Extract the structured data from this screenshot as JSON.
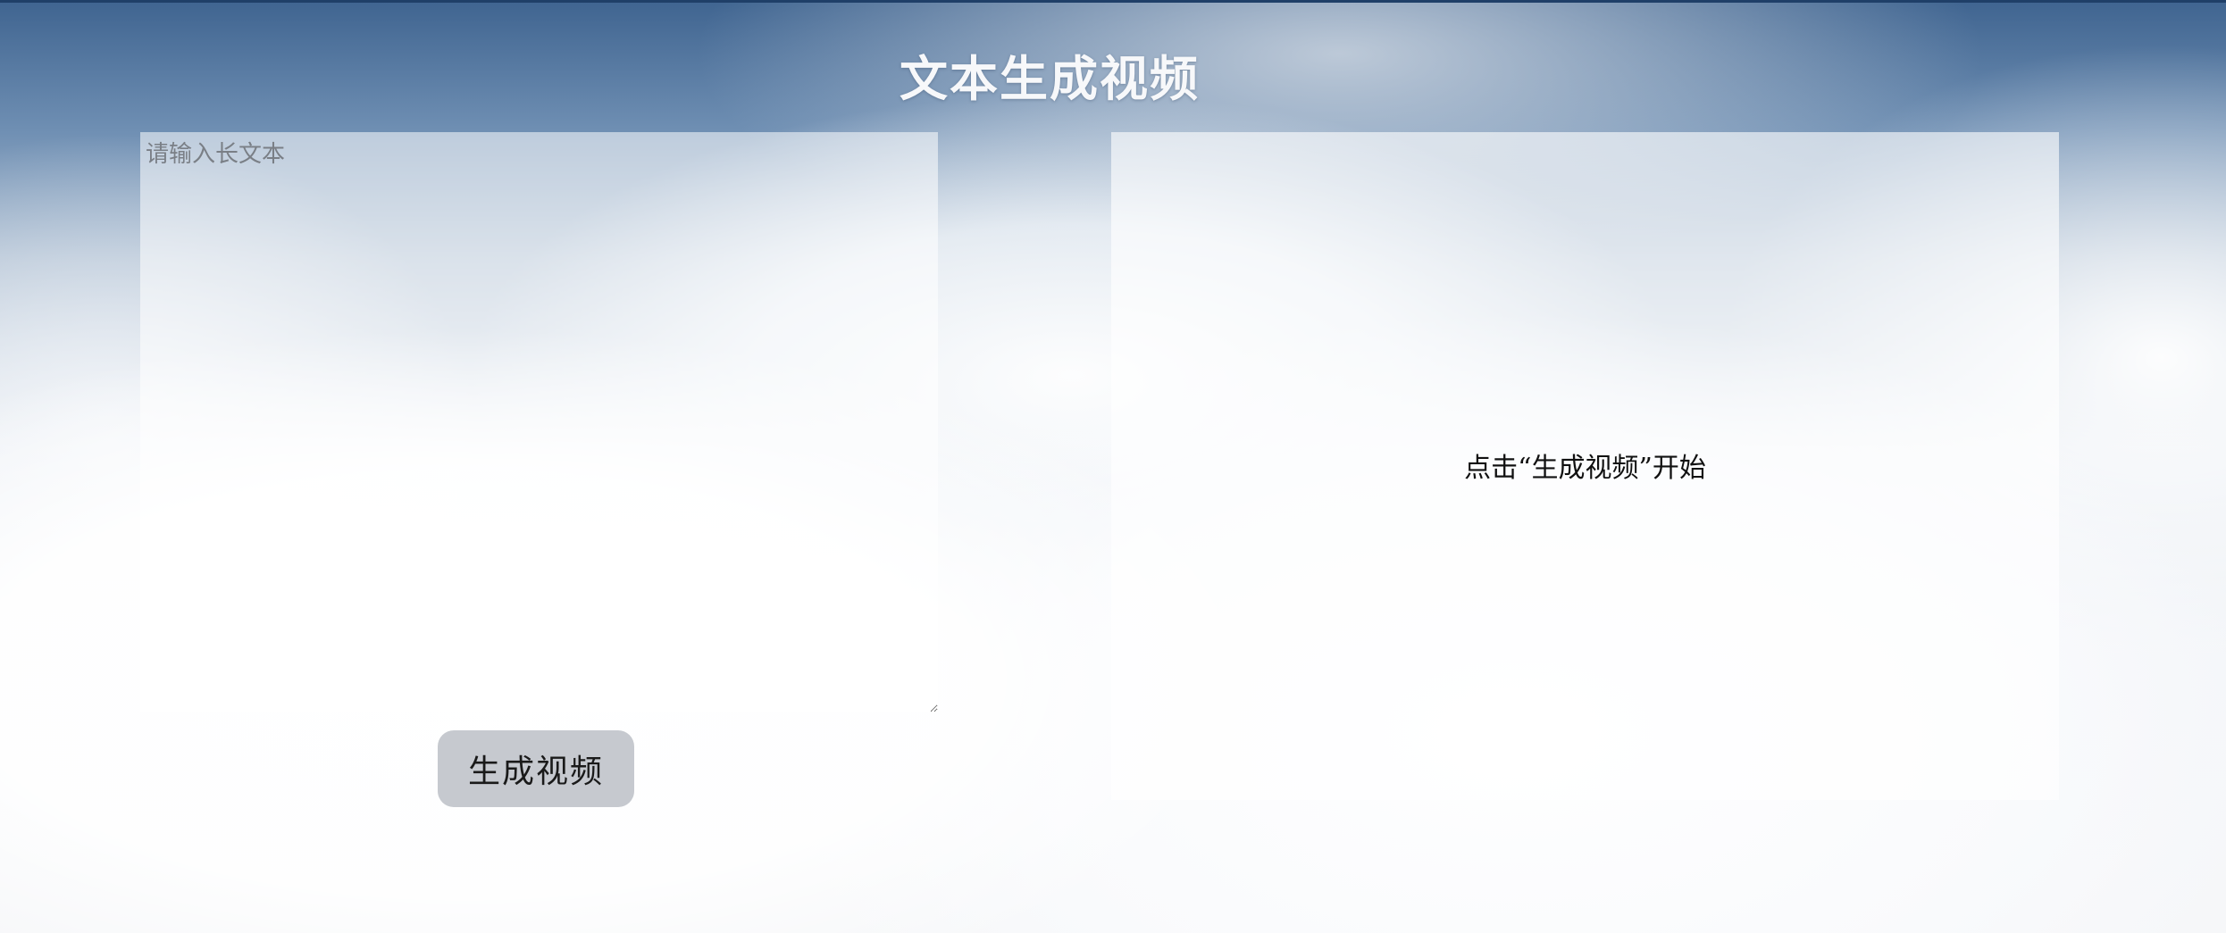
{
  "page": {
    "title": "文本生成视频"
  },
  "input": {
    "placeholder": "请输入长文本",
    "value": ""
  },
  "actions": {
    "generate_label": "生成视频"
  },
  "output": {
    "hint": "点击“生成视频”开始"
  },
  "colors": {
    "top_bar": "#1f3f68",
    "button_bg": "#c6c9cf",
    "title_text": "#f7f8fa"
  }
}
